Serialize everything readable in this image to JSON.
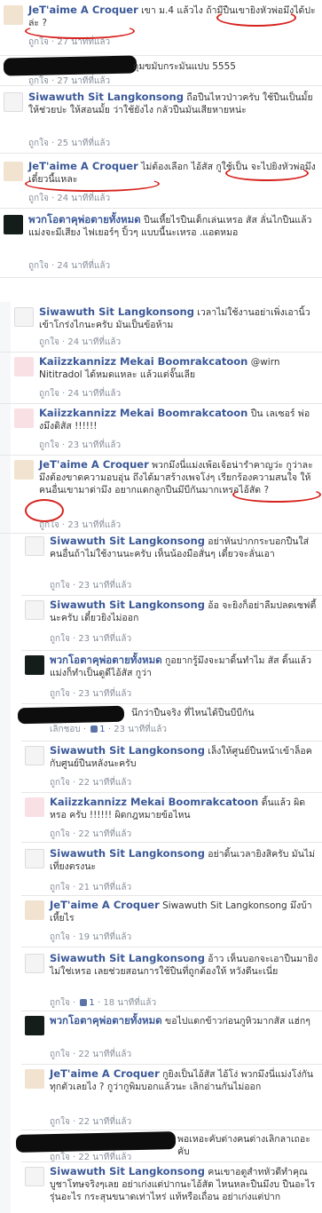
{
  "like_label": "ถูกใจ",
  "like_link_label": "เลิกชอบ",
  "comments": [
    {
      "author": "JeT'aime A Croquer",
      "text": "เขา ม.4 แล้วไง ถ้ามีปืนเขายิงหัวพ่อมึงได้ปะล่ะ ?",
      "time": "27 นาทีที่แล้ว"
    },
    {
      "author": "",
      "text": "กุมขมับกระมันแปบ 5555",
      "time": "27 นาทีที่แล้ว"
    },
    {
      "author": "Siwawuth Sit Langkonsong",
      "text": "ถือปืนไหวป่าวครับ ใช้ปืนเป็นมั้ย ให้ช่วยปะ ให้สอนมั้ย ว่าใช้ยังไง กลัวปืนมันเสียหายหน่ะ",
      "time": "25 นาทีที่แล้ว"
    },
    {
      "author": "JeT'aime A Croquer",
      "text": "ไม่ต้องเลือก ไอ้สัส กูใช้เป็น จะไปยิงหัวพ่อมึงเดี๋ยวนี้แหละ",
      "time": "24 นาทีที่แล้ว"
    },
    {
      "author": "พวกโอตาคุพ่อตายทั้งหมด",
      "text": "ปืนเหี้ยไรปืนเด็กเล่นเหรอ สัส ลั่นไกปืนแล้วแม่งจะมีเสียง ไฟเยอร์ๆ ปิ้วๆ แบบนี้นะเหรอ .แอดหมอ",
      "time": "24 นาทีที่แล้ว"
    },
    {
      "author": "Siwawuth Sit Langkonsong",
      "text": "เวลาไม่ใช้งานอย่าเพิ่งเอานิ้วเข้าโกร่งไกนะครับ มันเป็นข้อห้าม",
      "time": "24 นาทีที่แล้ว"
    },
    {
      "author": "Kaiizzkannizz Mekai Boomrakcatoon",
      "text": "@wirn Nititradol ได้หมดแหละ แล้วแต่จั๊นเลีย",
      "time": "24 นาทีที่แล้ว"
    },
    {
      "author": "Kaiizzkannizz Mekai Boomrakcatoon",
      "text": "ปืน เลเซอร์ พ่องมึงดิสัส !!!!!!",
      "time": "23 นาทีที่แล้ว"
    },
    {
      "author": "JeT'aime A Croquer",
      "text": "พวกมึงนี่แม่งเพ้อเจ้อน่ารำคาญว่ะ กูว่าละมึงต้องขาดความอบอุ่น ถึงได้มาสร้างเพจโง่ๆ เรียกร้องความสนใจ ให้คนอื่นเขามาด่ามึง อยากแดกลูกปืนมึบีกันมากเหรอไอ้สัด ?",
      "time": "23 นาทีที่แล้ว"
    },
    {
      "author": "Siwawuth Sit Langkonsong",
      "text": "อย่าหันปากกระบอกปืนใส่คนอื่นถ้าไม่ใช้งานนะครับ เห็นน้องมือสั่นๆ เดี๋ยวจะลั่นเอา",
      "time": "23 นาทีที่แล้ว"
    },
    {
      "author": "Siwawuth Sit Langkonsong",
      "text": "อ้อ จะยิงก็อย่าลืมปลดเซฟตี้นะครับ เดี๋ยวยิงไม่ออก",
      "time": "23 นาทีที่แล้ว"
    },
    {
      "author": "พวกโอตาคุพ่อตายทั้งหมด",
      "text": "กูอยากรู้มึงจะมาดิ้นทำไม สัส ดิ้นแล้วแม่งก็ทำเป็นดูดีไอ้สัส กูว่า",
      "time": "23 นาทีที่แล้ว"
    },
    {
      "author": "",
      "text": "นึกว่าปืนจริง ที่ไหนได้ปืนบีบีกัน",
      "time": "23 นาทีที่แล้ว",
      "likes": "1"
    },
    {
      "author": "Siwawuth Sit Langkonsong",
      "text": "เล็งให้ศูนย์ปืนหน้าเข้าล็อคกับศูนย์ปืนหลังนะครับ",
      "time": "22 นาทีที่แล้ว"
    },
    {
      "author": "Kaiizzkannizz Mekai Boomrakcatoon",
      "text": "ดิ้นแล้ว ผิดหรอ ครับ !!!!!! ผิดกฎหมายข้อไหน",
      "time": "22 นาทีที่แล้ว"
    },
    {
      "author": "Siwawuth Sit Langkonsong",
      "text": "อย่าดิ้นเวลายิงสิครับ มันไม่เที่ยงตรงนะ",
      "time": "21 นาทีที่แล้ว"
    },
    {
      "author": "JeT'aime A Croquer",
      "text": "Siwawuth Sit Langkonsong มึงบ้าเหี้ยไร",
      "time": "19 นาทีที่แล้ว"
    },
    {
      "author": "Siwawuth Sit Langkonsong",
      "text": "อ้าว เห็นบอกจะเอาปืนมายิงไม่ใช่เหรอ เลยช่วยสอนการใช้ปืนที่ถูกต้องให้ หวังดีนะเนี่ย",
      "time": "18 นาทีที่แล้ว",
      "likes": "1"
    },
    {
      "author": "พวกโอตาคุพ่อตายทั้งหมด",
      "text": "ขอไปแดกข้าวก่อนกูหิวมากสัส แฮ่กๆ",
      "time": "22 นาทีที่แล้ว"
    },
    {
      "author": "JeT'aime A Croquer",
      "text": "กูยิงเป็นไอ้สัส ไอ้โง่ พวกมึงนี่แม่งโง่กันทุกตัวเลยไง ? กูว่ากูพิมบอกแล้วนะ เลิกอ่านกันไม่ออก",
      "time": "22 นาทีที่แล้ว"
    },
    {
      "author": "",
      "text": "พอเหอะคับต่างคนต่างเลิกลาเถอะคับ",
      "time": "22 นาทีที่แล้ว"
    },
    {
      "author": "Siwawuth Sit Langkonsong",
      "text": "คนเขาอตูสำทหัวดีทำคุณบูชาโทษจริงๆเลย อย่าเก่งแต่ปากนะไอ้สัด ไหนหละปืนมึงบ ปืนอะไรรุ่นอะไร กระสุนขนาดเท่าไหร่ แท้หรือเถื่อน อย่าเก่งแต่ปาก",
      "time": ""
    }
  ]
}
